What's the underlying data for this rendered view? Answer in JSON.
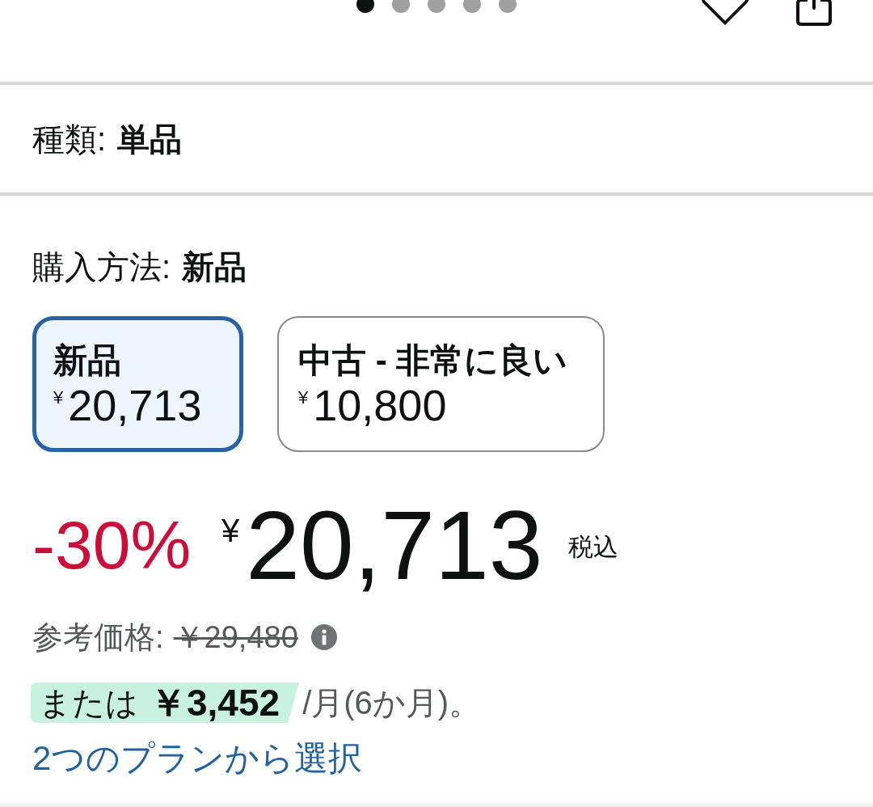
{
  "carousel": {
    "dots": [
      {
        "selected": true
      },
      {
        "selected": false
      },
      {
        "selected": false
      },
      {
        "selected": false
      },
      {
        "selected": false
      }
    ]
  },
  "variation": {
    "label": "種類:",
    "value": "単品"
  },
  "purchase_method": {
    "label": "購入方法:",
    "value": "新品"
  },
  "options": [
    {
      "title": "新品",
      "currency": "¥",
      "price": "20,713",
      "selected": true
    },
    {
      "title": "中古 - 非常に良い",
      "currency": "¥",
      "price": "10,800",
      "selected": false
    }
  ],
  "price": {
    "discount": "-30%",
    "currency": "¥",
    "amount": "20,713",
    "tax_note": "税込"
  },
  "reference_price": {
    "label": "参考価格:",
    "price": "￥29,480"
  },
  "installment": {
    "prefix": "または",
    "amount": "￥3,452",
    "term": "/月(6か月)。"
  },
  "plans_link": "2つのプランから選択"
}
